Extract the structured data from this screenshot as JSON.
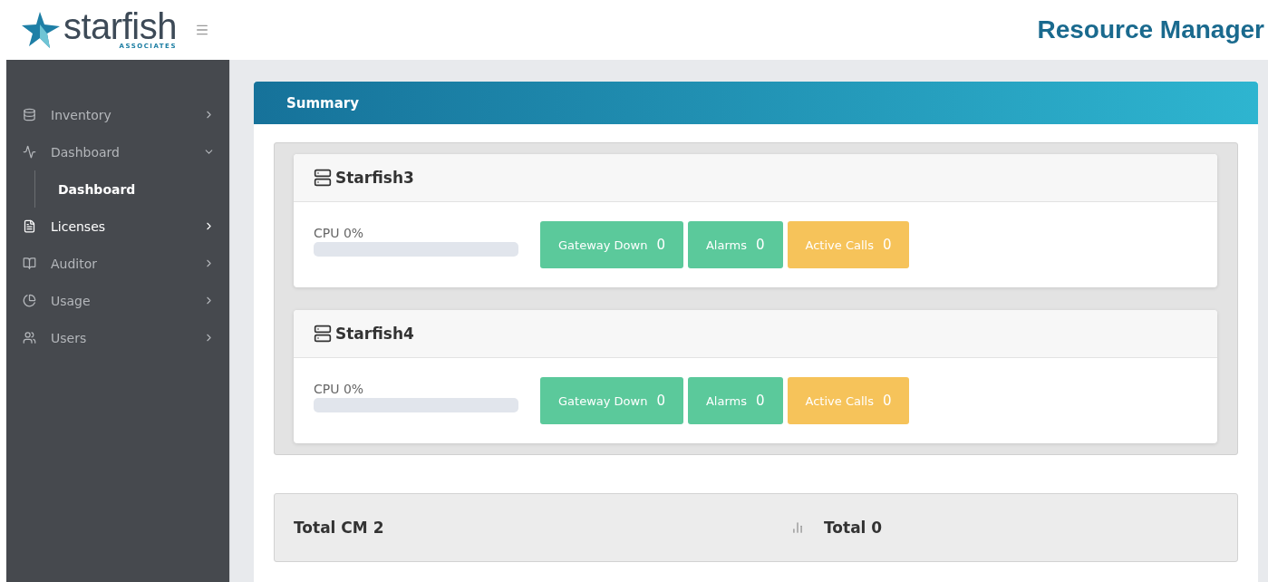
{
  "header": {
    "logo": {
      "name": "starfish",
      "tagline": "ASSOCIATES"
    },
    "title": "Resource Manager"
  },
  "sidebar": {
    "items": [
      {
        "label": "Inventory",
        "expanded": false,
        "highlighted": false
      },
      {
        "label": "Dashboard",
        "expanded": true,
        "highlighted": false,
        "children": [
          {
            "label": "Dashboard",
            "selected": true
          }
        ]
      },
      {
        "label": "Licenses",
        "expanded": false,
        "highlighted": true
      },
      {
        "label": "Auditor",
        "expanded": false,
        "highlighted": false
      },
      {
        "label": "Usage",
        "expanded": false,
        "highlighted": false
      },
      {
        "label": "Users",
        "expanded": false,
        "highlighted": false
      }
    ]
  },
  "summary": {
    "title": "Summary",
    "servers": [
      {
        "name": "Starfish3",
        "cpu_label": "CPU 0%",
        "cpu": {
          "level": 0
        },
        "stats": [
          {
            "label": "Gateway Down",
            "value": "0",
            "color": "#5bc99b"
          },
          {
            "label": "Alarms",
            "value": "0",
            "color": "#5bc99b"
          },
          {
            "label": "Active Calls",
            "value": "0",
            "color": "#f6c35a"
          }
        ]
      },
      {
        "name": "Starfish4",
        "cpu_label": "CPU 0%",
        "cpu": {
          "level": 0
        },
        "stats": [
          {
            "label": "Gateway Down",
            "value": "0",
            "color": "#5bc99b"
          },
          {
            "label": "Alarms",
            "value": "0",
            "color": "#5bc99b"
          },
          {
            "label": "Active Calls",
            "value": "0",
            "color": "#f6c35a"
          }
        ]
      }
    ],
    "totals": {
      "total_cm": "Total CM 2",
      "total": "Total 0"
    }
  }
}
